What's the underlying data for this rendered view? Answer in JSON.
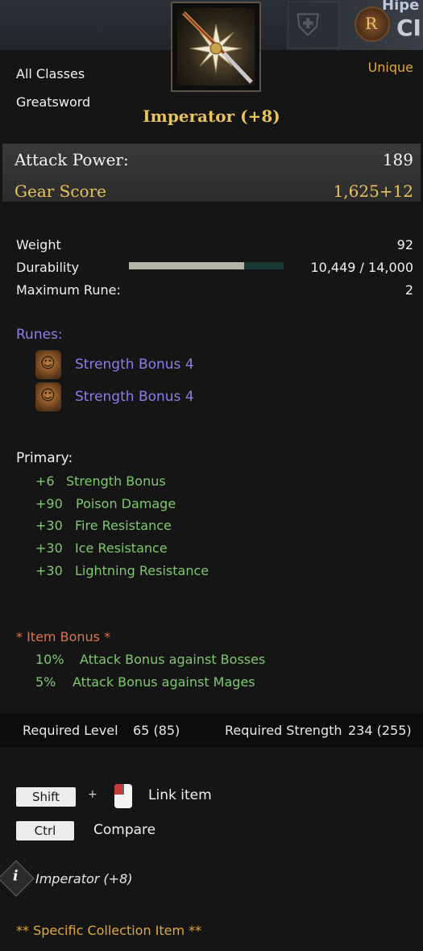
{
  "header": {
    "ghost_title_top": "Hipe",
    "ghost_title_bottom": "CI",
    "rune_emblem_letter": "R"
  },
  "item": {
    "class_restriction": "All Classes",
    "weapon_type": "Greatsword",
    "rarity": "Unique",
    "name": "Imperator (+8)"
  },
  "stats": {
    "attack_power_label": "Attack Power:",
    "attack_power_value": "189",
    "gear_score_label": "Gear Score",
    "gear_score_value": "1,625+12"
  },
  "details": {
    "weight_label": "Weight",
    "weight_value": "92",
    "durability_label": "Durability",
    "durability_value": "10,449 / 14,000",
    "durability_fraction": 0.746,
    "max_rune_label": "Maximum Rune:",
    "max_rune_value": "2"
  },
  "runes": {
    "heading": "Runes:",
    "items": [
      {
        "name": "Strength Bonus 4"
      },
      {
        "name": "Strength Bonus 4"
      }
    ]
  },
  "primary": {
    "heading": "Primary:",
    "bonuses": [
      {
        "value": "+6",
        "name": "Strength Bonus"
      },
      {
        "value": "+90",
        "name": "Poison Damage"
      },
      {
        "value": "+30",
        "name": "Fire Resistance"
      },
      {
        "value": "+30",
        "name": "Ice Resistance"
      },
      {
        "value": "+30",
        "name": "Lightning Resistance"
      }
    ]
  },
  "item_bonus": {
    "heading": "*  Item Bonus *",
    "bonuses": [
      {
        "value": "10%",
        "name": "Attack Bonus against Bosses"
      },
      {
        "value": "5%",
        "name": "Attack Bonus against Mages"
      }
    ]
  },
  "requirements": {
    "level_label": "Required Level",
    "level_value": "65 (85)",
    "strength_label": "Required Strength",
    "strength_value": "234 (255)"
  },
  "controls": {
    "shift_key": "Shift",
    "plus": "+",
    "link_item": "Link item",
    "ctrl_key": "Ctrl",
    "compare": "Compare"
  },
  "footer": {
    "info_letter": "i",
    "item_name": "Imperator (+8)",
    "collection_note": "** Specific Collection Item **"
  },
  "colors": {
    "rarity_unique": "#e2a83a",
    "item_name": "#e8c25a",
    "rune_text": "#8a7fe8",
    "bonus_green": "#7ec86e",
    "item_bonus_head": "#e0704a"
  },
  "icons": {
    "item": "greatsword-icon",
    "armor": "armor-icon",
    "rune_emblem": "rune-emblem-icon",
    "rune": "rune-icon",
    "mouse": "mouse-icon",
    "info": "info-icon"
  }
}
